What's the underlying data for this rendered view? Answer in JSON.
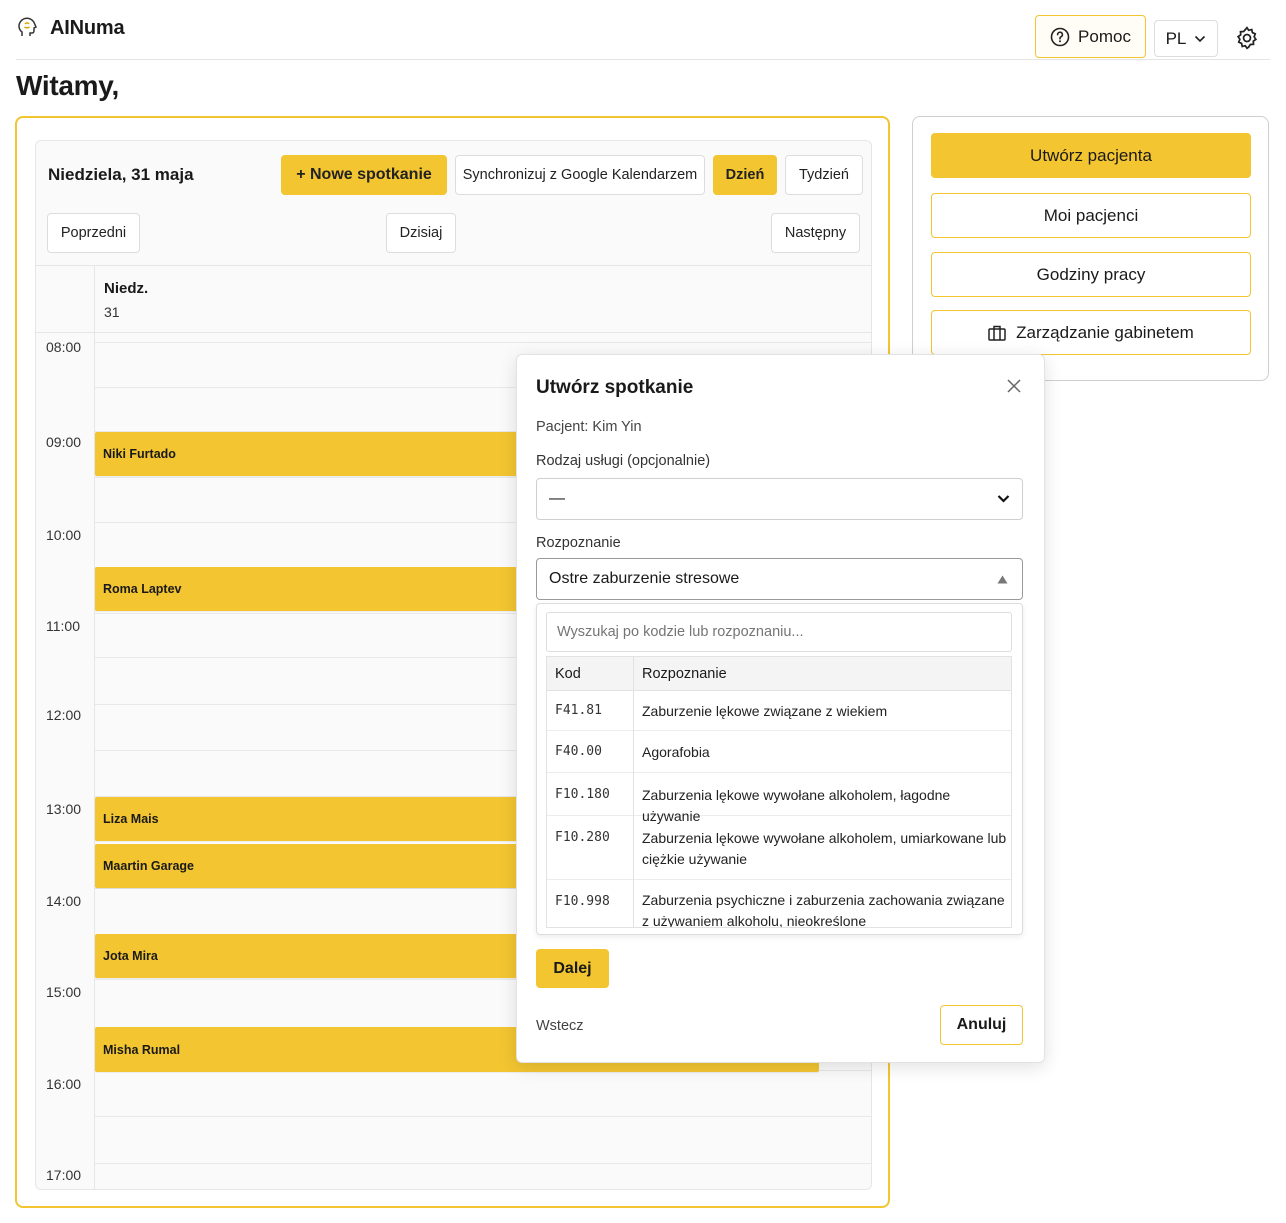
{
  "header": {
    "app_name": "AINuma",
    "help_label": "Pomoc",
    "language": "PL"
  },
  "welcome": "Witamy,",
  "calendar": {
    "date_title": "Niedziela, 31 maja",
    "new_appointment_label": "+  Nowe spotkanie",
    "sync_label": "Synchronizuj z Google Kalendarzem",
    "view_day_label": "Dzień",
    "view_week_label": "Tydzień",
    "prev_label": "Poprzedni",
    "today_label": "Dzisiaj",
    "next_label": "Następny",
    "day_name": "Niedz.",
    "day_number": "31",
    "hours": [
      "08:00",
      "09:00",
      "10:00",
      "11:00",
      "12:00",
      "13:00",
      "14:00",
      "15:00",
      "16:00",
      "17:00"
    ],
    "events": [
      {
        "name": "Niki Furtado"
      },
      {
        "name": "Roma Laptev"
      },
      {
        "name": "Liza Mais"
      },
      {
        "name": "Maartin Garage"
      },
      {
        "name": "Jota Mira"
      },
      {
        "name": "Misha Rumal"
      }
    ]
  },
  "side_panel": {
    "create_patient": "Utwórz pacjenta",
    "my_patients": "Moi pacjenci",
    "working_hours": "Godziny pracy",
    "office_management": "Zarządzanie gabinetem"
  },
  "modal": {
    "title": "Utwórz spotkanie",
    "patient": "Pacjent: Kim Yin",
    "service_label": "Rodzaj usługi (opcjonalnie)",
    "service_value": "—",
    "diagnosis_label": "Rozpoznanie",
    "diagnosis_value": "Ostre zaburzenie stresowe",
    "search_placeholder": "Wyszukaj po kodzie lub rozpoznaniu...",
    "col_code": "Kod",
    "col_diagnosis": "Rozpoznanie",
    "rows": [
      {
        "code": "F41.81",
        "desc": "Zaburzenie lękowe związane z wiekiem"
      },
      {
        "code": "F40.00",
        "desc": "Agorafobia"
      },
      {
        "code": "F10.180",
        "desc": "Zaburzenia lękowe wywołane alkoholem, łagodne używanie"
      },
      {
        "code": "F10.280",
        "desc": "Zaburzenia lękowe wywołane alkoholem, umiarkowane lub ciężkie używanie"
      },
      {
        "code": "F10.998",
        "desc": "Zaburzenia psychiczne i zaburzenia zachowania związane z używaniem alkoholu, nieokreślone"
      }
    ],
    "next_label": "Dalej",
    "back_label": "Wstecz",
    "cancel_label": "Anuluj"
  }
}
